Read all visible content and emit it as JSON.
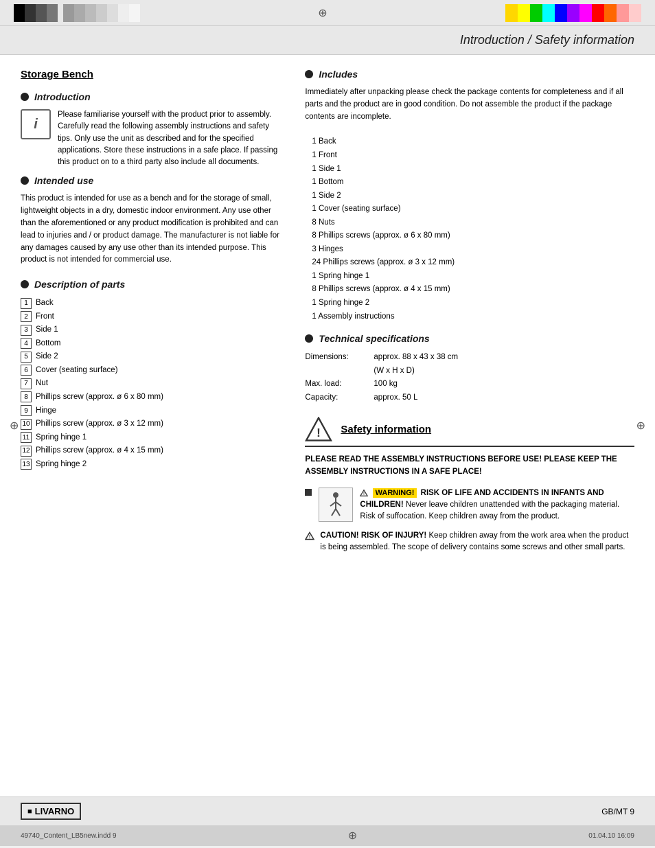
{
  "colorBar": {
    "crosshair": "⊕",
    "colors": [
      "#000",
      "#333",
      "#555",
      "#777",
      "#999",
      "#bbb",
      "#ddd",
      "#fff",
      "#fff",
      "#ffd700",
      "#ff0",
      "#0f0",
      "#0ff",
      "#00f",
      "#f0f",
      "#f00",
      "#f88",
      "#fcc"
    ]
  },
  "header": {
    "title": "Introduction / Safety information"
  },
  "leftColumn": {
    "mainTitle": "Storage Bench",
    "introduction": {
      "heading": "Introduction",
      "infoText": "Please familiarise yourself with the product prior to assembly. Carefully read the following assembly instructions and safety tips. Only use the unit as described and for the specified applications. Store these instructions in a safe place. If passing this product on to a third party also include all documents."
    },
    "intendedUse": {
      "heading": "Intended use",
      "body": "This product is intended for use as a bench and for the storage of small, lightweight objects in a dry, domestic indoor environment. Any use other than the aforementioned or any product modification is prohibited and can lead to injuries and / or product damage. The manufacturer is not liable for any damages caused by any use other than its intended purpose. This product is not intended for commercial use."
    },
    "descriptionOfParts": {
      "heading": "Description of parts",
      "parts": [
        {
          "num": "1",
          "label": "Back"
        },
        {
          "num": "2",
          "label": "Front"
        },
        {
          "num": "3",
          "label": "Side 1"
        },
        {
          "num": "4",
          "label": "Bottom"
        },
        {
          "num": "5",
          "label": "Side 2"
        },
        {
          "num": "6",
          "label": "Cover (seating surface)"
        },
        {
          "num": "7",
          "label": "Nut"
        },
        {
          "num": "8",
          "label": "Phillips screw (approx. ø 6 x 80 mm)"
        },
        {
          "num": "9",
          "label": "Hinge"
        },
        {
          "num": "10",
          "label": "Phillips screw (approx. ø 3 x 12 mm)"
        },
        {
          "num": "11",
          "label": "Spring hinge 1"
        },
        {
          "num": "12",
          "label": "Phillips screw (approx. ø 4 x 15 mm)"
        },
        {
          "num": "13",
          "label": "Spring hinge 2"
        }
      ]
    }
  },
  "rightColumn": {
    "includes": {
      "heading": "Includes",
      "intro": "Immediately after unpacking please check the package contents for completeness and if all parts and the product are in good condition. Do not assemble the product if the package contents are incomplete.",
      "items": [
        "1  Back",
        "1  Front",
        "1  Side 1",
        "1  Bottom",
        "1  Side 2",
        "1  Cover (seating surface)",
        "8  Nuts",
        "8  Phillips screws (approx. ø 6 x 80 mm)",
        "3  Hinges",
        "24 Phillips screws (approx. ø 3 x 12 mm)",
        "1  Spring hinge 1",
        "8  Phillips screws (approx. ø 4 x 15 mm)",
        "1  Spring hinge 2",
        "1  Assembly instructions"
      ]
    },
    "technicalSpecs": {
      "heading": "Technical specifications",
      "specs": [
        {
          "label": "Dimensions:",
          "value": "approx. 88 x 43 x 38 cm\n(W x H x D)"
        },
        {
          "label": "Max. load:",
          "value": "100 kg"
        },
        {
          "label": "Capacity:",
          "value": "approx. 50 L"
        }
      ]
    },
    "safetyInformation": {
      "heading": "Safety information",
      "boldText": "PLEASE READ THE ASSEMBLY INSTRUCTIONS BEFORE USE! PLEASE KEEP THE ASSEMBLY INSTRUCTIONS IN A SAFE PLACE!",
      "warningTitle": "WARNING!",
      "warningText": "RISK OF LIFE AND ACCIDENTS IN INFANTS AND CHILDREN!",
      "warningDetail": "Never leave children unattended with the packaging material. Risk of suffocation. Keep children away from the product.",
      "cautionTitle": "CAUTION! RISK OF INJURY!",
      "cautionText": "Keep children away from the work area when the product is being assembled. The scope of delivery contains some screws and other small parts."
    }
  },
  "footer": {
    "logoText": "LIVARNO",
    "footerRight": "GB/MT    9",
    "bottomLeft": "49740_Content_LB5new.indd   9",
    "bottomRight": "01.04.10   16:09"
  }
}
